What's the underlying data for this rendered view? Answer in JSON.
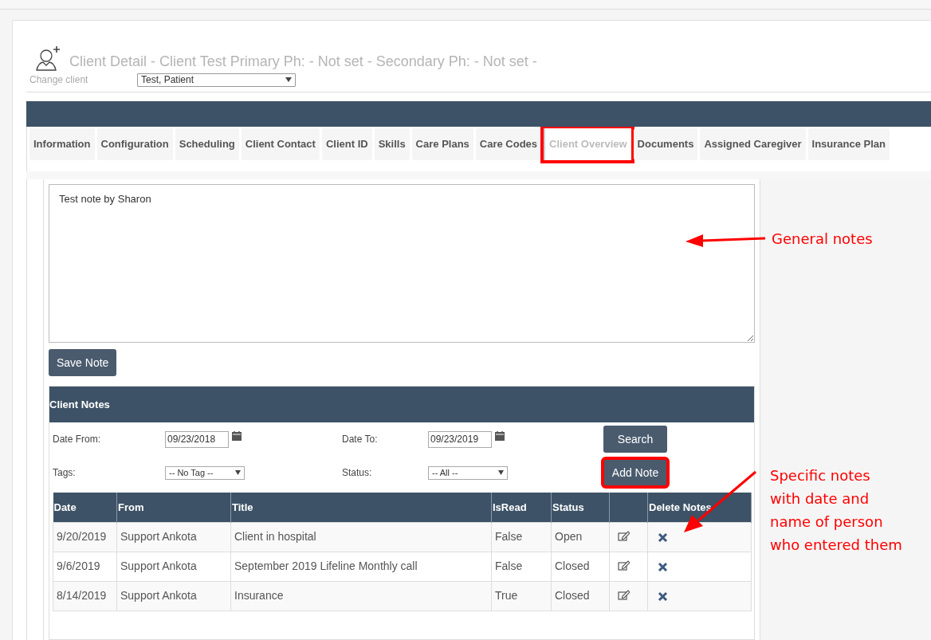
{
  "header": {
    "title": "Client Detail - Client Test Primary Ph: - Not set - Secondary Ph: - Not set -",
    "change_client_label": "Change client",
    "client_select": {
      "value": "Test, Patient"
    }
  },
  "tabs": [
    {
      "label": "Information",
      "selected": false,
      "highlighted": false
    },
    {
      "label": "Configuration",
      "selected": false,
      "highlighted": false
    },
    {
      "label": "Scheduling",
      "selected": false,
      "highlighted": false
    },
    {
      "label": "Client Contact",
      "selected": false,
      "highlighted": false
    },
    {
      "label": "Client ID",
      "selected": false,
      "highlighted": false
    },
    {
      "label": "Skills",
      "selected": false,
      "highlighted": false
    },
    {
      "label": "Care Plans",
      "selected": false,
      "highlighted": false
    },
    {
      "label": "Care Codes",
      "selected": false,
      "highlighted": false
    },
    {
      "label": "Client Overview",
      "selected": true,
      "highlighted": true
    },
    {
      "label": "Documents",
      "selected": false,
      "highlighted": false
    },
    {
      "label": "Assigned Caregiver",
      "selected": false,
      "highlighted": false
    },
    {
      "label": "Insurance Plan",
      "selected": false,
      "highlighted": false
    }
  ],
  "general_note": {
    "value": "Test note by Sharon"
  },
  "save_button": {
    "label": "Save Note"
  },
  "client_notes": {
    "title": "Client Notes",
    "filters": [
      {
        "label": "Date From:",
        "kind": "date",
        "value": "09/23/2018"
      },
      {
        "label": "Date To:",
        "kind": "date",
        "value": "09/23/2019"
      },
      {
        "label": "Tags:",
        "kind": "select",
        "value": "-- No Tag --"
      },
      {
        "label": "Status:",
        "kind": "select",
        "value": "-- All --"
      }
    ],
    "search_button": {
      "label": "Search",
      "highlighted": false
    },
    "add_button": {
      "label": "Add Note",
      "highlighted": true
    },
    "columns": [
      {
        "label": "Date"
      },
      {
        "label": "From"
      },
      {
        "label": "Title"
      },
      {
        "label": "IsRead"
      },
      {
        "label": "Status"
      },
      {
        "kind": "edit"
      },
      {
        "label": "Delete Notes"
      }
    ],
    "rows": [
      {
        "date": "9/20/2019",
        "from": "Support Ankota",
        "title": "Client in hospital",
        "is_read": "False",
        "status": "Open"
      },
      {
        "date": "9/6/2019",
        "from": "Support Ankota",
        "title": "September 2019 Lifeline Monthly call",
        "is_read": "False",
        "status": "Closed"
      },
      {
        "date": "8/14/2019",
        "from": "Support Ankota",
        "title": "Insurance",
        "is_read": "True",
        "status": "Closed"
      }
    ]
  },
  "annotations": [
    {
      "kind": "callout",
      "text": "General notes"
    },
    {
      "kind": "callout",
      "text": "Specific notes\nwith date and\nname of person\nwho entered them"
    }
  ]
}
